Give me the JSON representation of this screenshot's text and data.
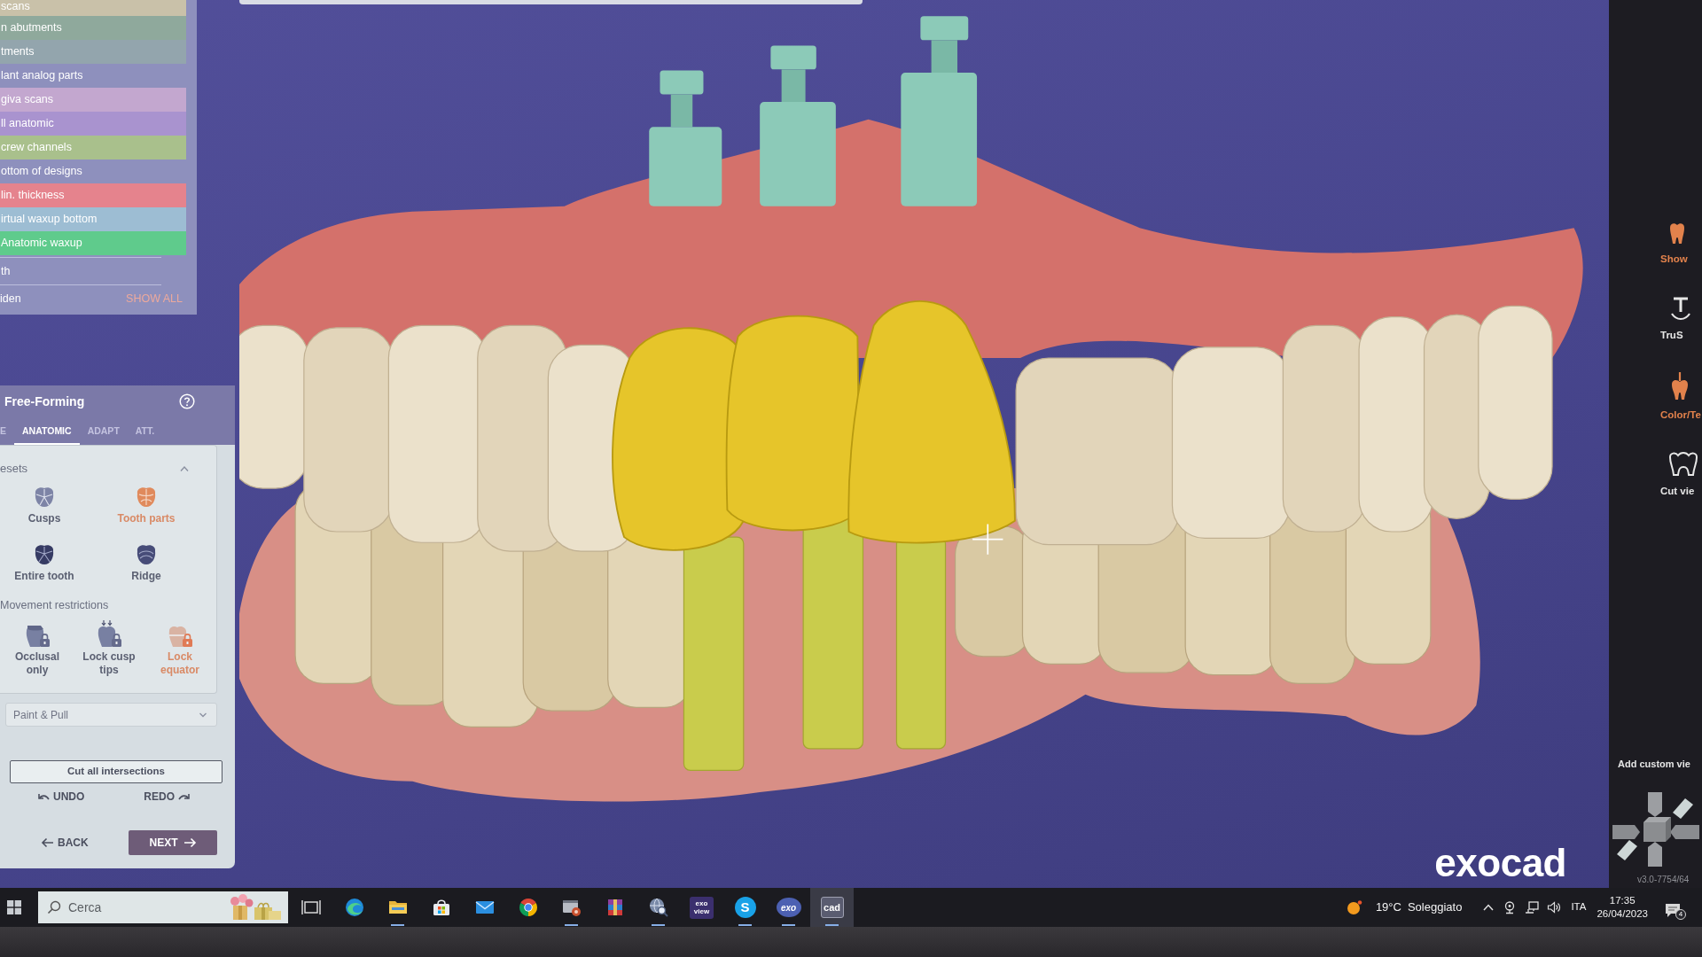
{
  "layers": {
    "items": [
      {
        "label": "scans",
        "color": "#c9c1a9"
      },
      {
        "label": "n abutments",
        "color": "#8fa99c"
      },
      {
        "label": "tments",
        "color": "#93a5ad"
      },
      {
        "label": "lant analog parts"
      },
      {
        "label": "giva scans",
        "color": "#c3a7cf"
      },
      {
        "label": "ll anatomic",
        "color": "#a993cf"
      },
      {
        "label": "crew channels",
        "color": "#a9c08c"
      },
      {
        "label": "ottom of designs"
      },
      {
        "label": "lin. thickness",
        "color": "#e5838d"
      },
      {
        "label": "irtual waxup bottom",
        "color": "#9dbdd3"
      },
      {
        "label": "Anatomic waxup",
        "color": "#5fcb8c"
      }
    ],
    "teeth_row": "th",
    "hidden_row": {
      "label": "iden",
      "button": "SHOW ALL"
    }
  },
  "free_forming": {
    "title": "Free-Forming",
    "tabs": [
      {
        "label": "E",
        "selected": false
      },
      {
        "label": "ANATOMIC",
        "selected": true
      },
      {
        "label": "ADAPT",
        "selected": false
      },
      {
        "label": "ATT.",
        "selected": false
      }
    ],
    "presets": {
      "title": "esets",
      "expanded": true,
      "items": [
        {
          "label": "Cusps",
          "kind": "cusps",
          "selected": false
        },
        {
          "label": "Tooth parts",
          "kind": "parts",
          "selected": true
        },
        {
          "label": "Entire tooth",
          "kind": "entire",
          "selected": false
        },
        {
          "label": "Ridge",
          "kind": "ridge",
          "selected": false
        }
      ]
    },
    "restrictions": {
      "title": "Movement restrictions",
      "items": [
        {
          "label": "Occlusal only",
          "kind": "occlusal",
          "selected": false
        },
        {
          "label": "Lock cusp tips",
          "kind": "cusptips",
          "selected": false
        },
        {
          "label": "Lock equator",
          "kind": "equator",
          "selected": true
        }
      ]
    },
    "mode": {
      "value": "Paint & Pull"
    },
    "cut_button": "Cut all intersections",
    "undo": "UNDO",
    "redo": "REDO",
    "back": "BACK",
    "next": "NEXT"
  },
  "viewport": {
    "logo": "exocad"
  },
  "right_toolbar": {
    "items": [
      {
        "label": "Show",
        "kind": "show",
        "on": true
      },
      {
        "label": "TruS",
        "kind": "smile",
        "on": false
      },
      {
        "label": "Color/Te",
        "kind": "texture",
        "on": true
      },
      {
        "label": "Cut vie",
        "kind": "cut",
        "on": false
      }
    ],
    "custom_view": "Add custom vie",
    "version": "v3.0-7754/64"
  },
  "taskbar": {
    "search": {
      "placeholder": "Cerca"
    },
    "apps": [
      {
        "kind": "taskview",
        "running": false,
        "active": false
      },
      {
        "kind": "swirl",
        "running": false,
        "active": false
      },
      {
        "kind": "folder",
        "running": true,
        "active": false
      },
      {
        "kind": "store",
        "running": false,
        "active": false
      },
      {
        "kind": "mail",
        "running": false,
        "active": false
      },
      {
        "kind": "tricolor",
        "running": false,
        "active": false
      },
      {
        "kind": "viewer",
        "running": true,
        "active": false
      },
      {
        "kind": "archive",
        "running": false,
        "active": false
      },
      {
        "kind": "scan",
        "running": true,
        "active": false
      },
      {
        "kind": "exoview",
        "text": "exo view",
        "running": false,
        "active": false
      },
      {
        "kind": "chat",
        "text": "S",
        "running": true,
        "active": false
      },
      {
        "kind": "exo",
        "text": "exo",
        "running": true,
        "active": false
      },
      {
        "kind": "cad",
        "text": "cad",
        "running": true,
        "active": true
      }
    ],
    "weather": {
      "temperature": "19°C",
      "condition": "Soleggiato"
    },
    "language": "ITA",
    "time": "17:35",
    "date": "26/04/2023",
    "notification_count": "4"
  }
}
